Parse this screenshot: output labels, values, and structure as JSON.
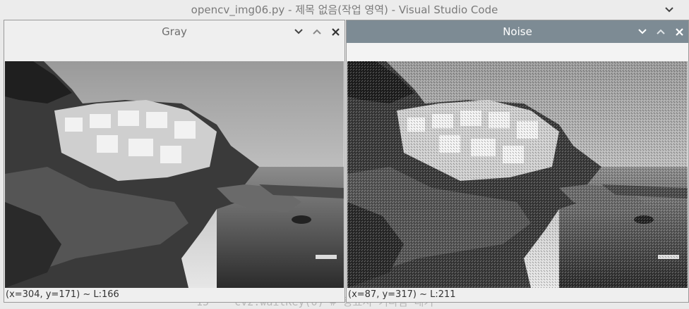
{
  "app": {
    "window_title": "opencv_img06.py - 제목 없음(작업 영역) - Visual Studio Code"
  },
  "editor": {
    "line_text": "15    cv2.waitKey(0) # 종료시 기다림 대기"
  },
  "windows": [
    {
      "title": "Gray",
      "status": "(x=304, y=171) ~ L:166",
      "active": false
    },
    {
      "title": "Noise",
      "status": "(x=87, y=317) ~ L:211",
      "active": true
    }
  ],
  "icons": {
    "minimize": "chevron-down-icon",
    "maximize": "chevron-up-icon",
    "close": "close-icon"
  },
  "colors": {
    "active_titlebar": "#7d8b94",
    "inactive_titlebar": "#efefef"
  }
}
